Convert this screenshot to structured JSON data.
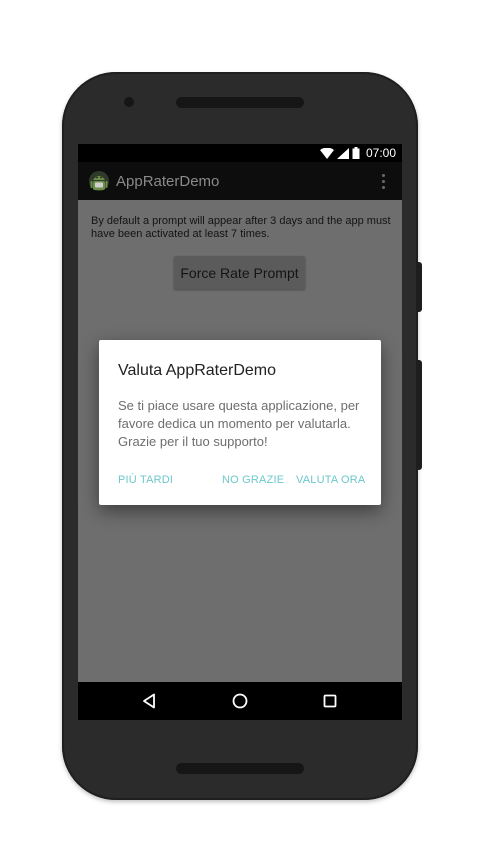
{
  "status_bar": {
    "time": "07:00",
    "icons": [
      "wifi-icon",
      "signal-icon",
      "battery-icon"
    ]
  },
  "app_bar": {
    "title": "AppRaterDemo",
    "app_icon": "android-robot-icon",
    "menu_icon": "overflow-menu-icon"
  },
  "content": {
    "description": "By default a prompt will appear after 3 days and the app must have been activated at least 7 times.",
    "button_label": "Force Rate Prompt"
  },
  "dialog": {
    "title": "Valuta AppRaterDemo",
    "message": "Se ti piace usare questa applicazione, per favore dedica un momento per valutarla. Grazie per il tuo supporto!",
    "buttons": {
      "later": "PIÙ TARDI",
      "no_thanks": "NO GRAZIE",
      "rate_now": "VALUTA ORA"
    }
  },
  "nav_bar": {
    "icons": [
      "back-icon",
      "home-icon",
      "recent-apps-icon"
    ]
  },
  "colors": {
    "accent": "#6cc8cc",
    "scrim": "#6e6e6e",
    "device": "#2b2b2b"
  }
}
